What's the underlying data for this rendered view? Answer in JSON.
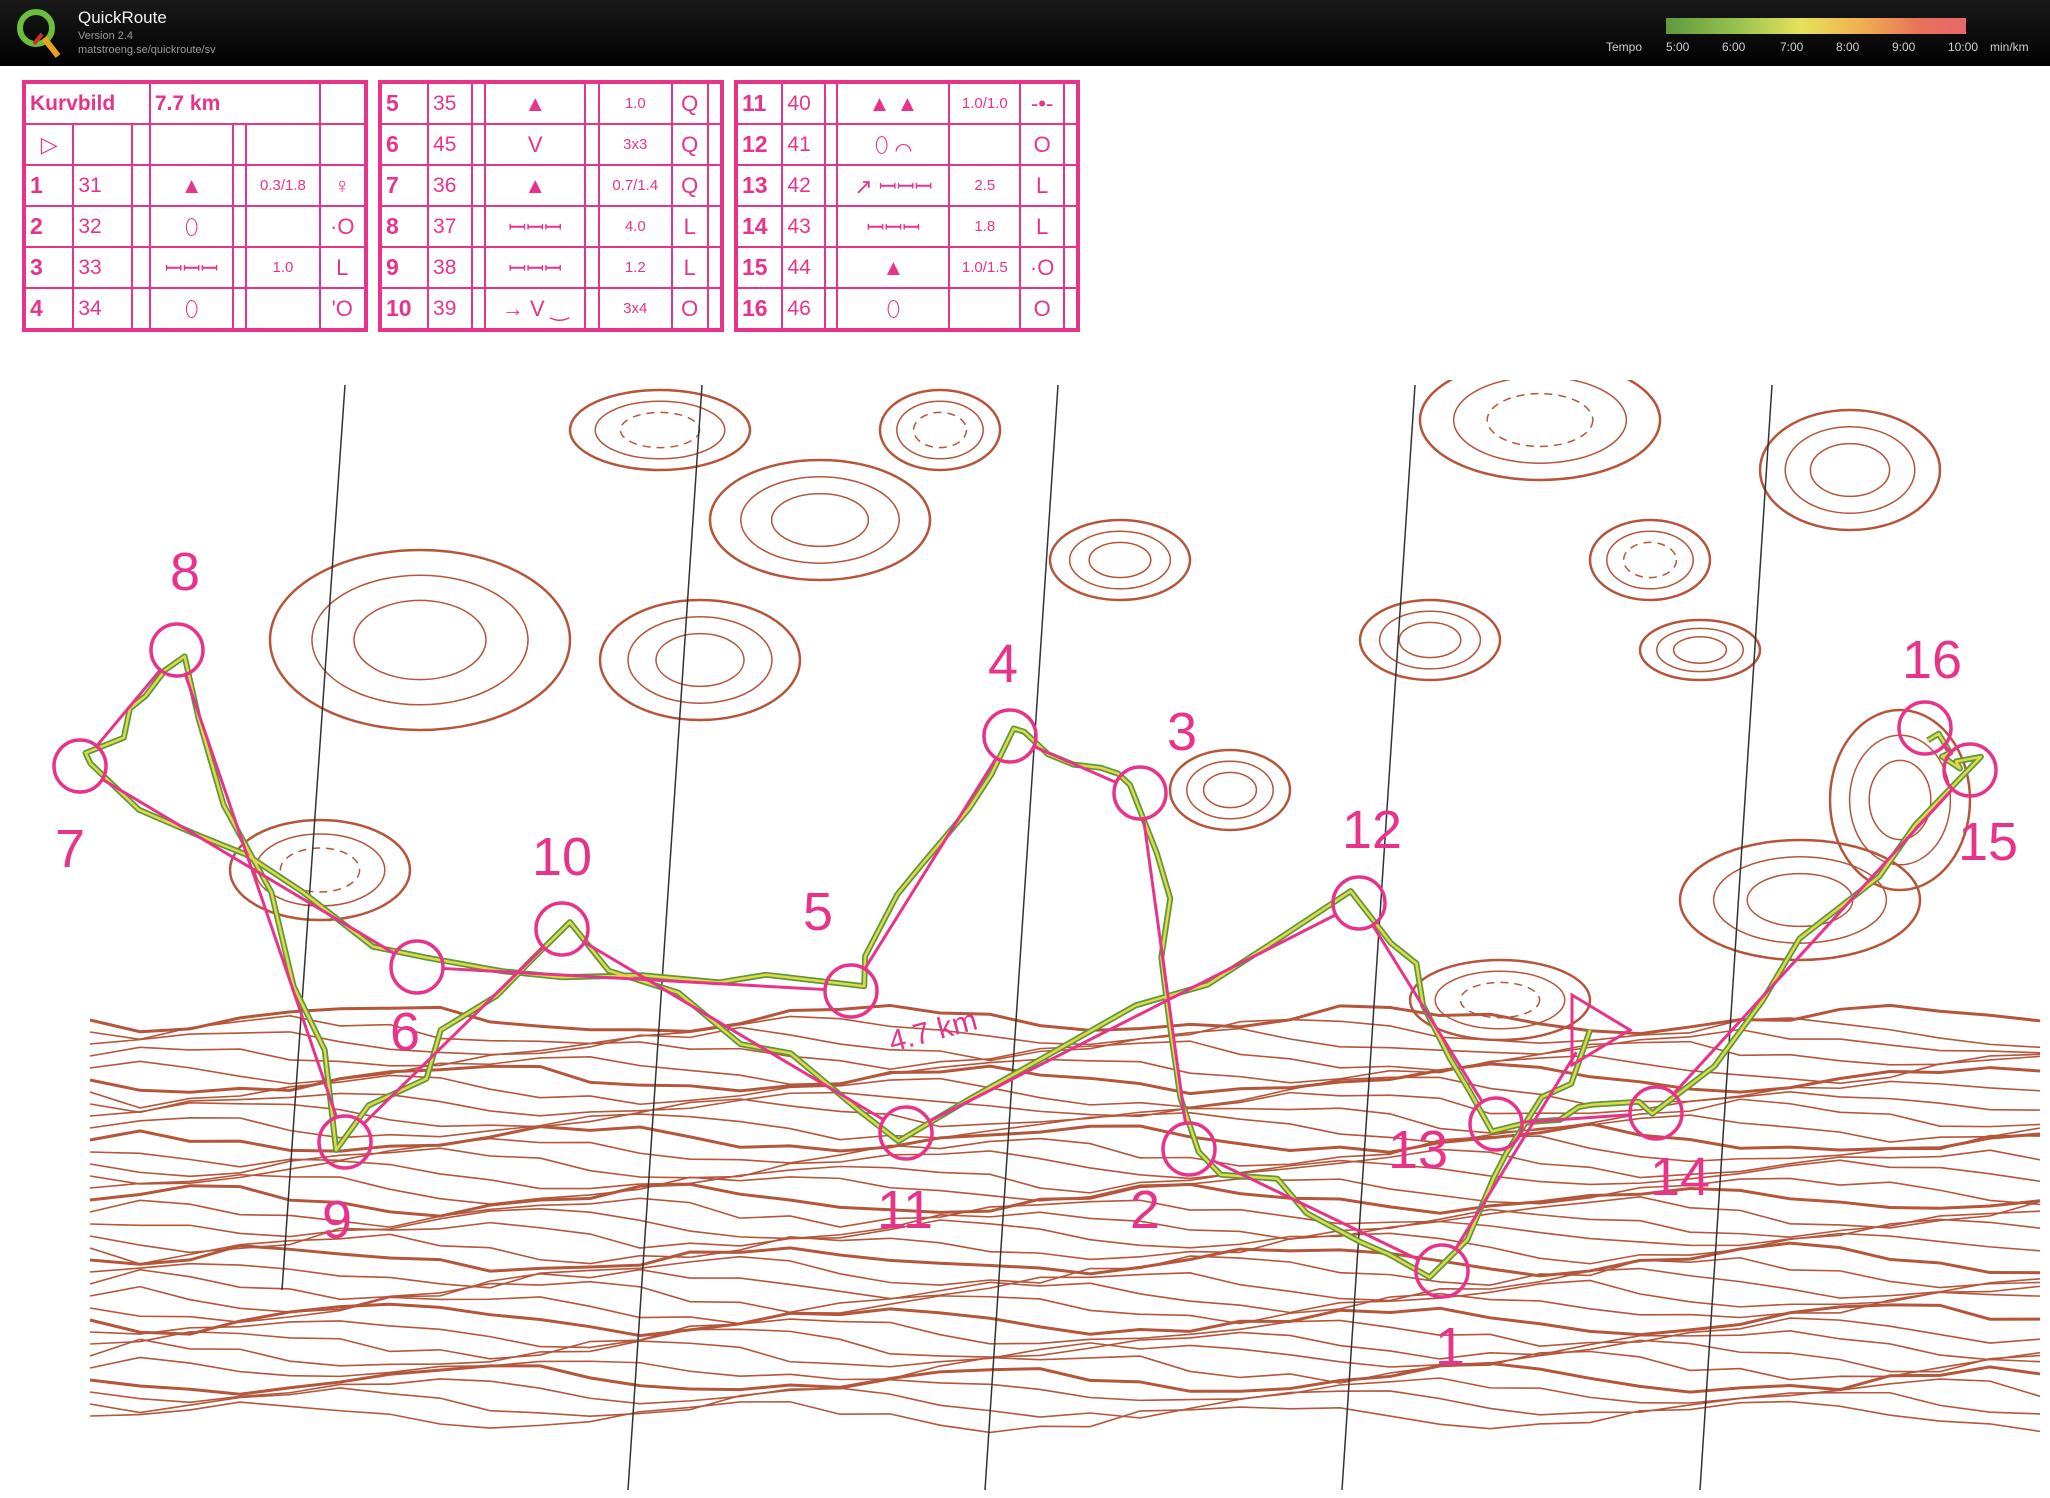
{
  "app": {
    "title": "QuickRoute",
    "version": "Version 2.4",
    "url": "matstroeng.se/quickroute/sv"
  },
  "tempo": {
    "label": "Tempo",
    "ticks": [
      "5:00",
      "6:00",
      "7:00",
      "8:00",
      "9:00",
      "10:00"
    ],
    "unit": "min/km"
  },
  "description": {
    "event": "Kurvbild",
    "length": "7.7 km",
    "start_symbol": "▷",
    "controls": [
      {
        "num": "1",
        "code": "31",
        "feature": "▲",
        "dim": "0.3/1.8",
        "pos": "♀"
      },
      {
        "num": "2",
        "code": "32",
        "feature": "⬯",
        "dim": "",
        "pos": "·O"
      },
      {
        "num": "3",
        "code": "33",
        "feature": "ꟷꟷꟷ",
        "dim": "1.0",
        "pos": "L"
      },
      {
        "num": "4",
        "code": "34",
        "feature": "⬯",
        "dim": "",
        "pos": "'O"
      },
      {
        "num": "5",
        "code": "35",
        "feature": "▲",
        "dim": "1.0",
        "pos": "Q"
      },
      {
        "num": "6",
        "code": "45",
        "feature": "V",
        "dim": "3x3",
        "pos": "Q"
      },
      {
        "num": "7",
        "code": "36",
        "feature": "▲",
        "dim": "0.7/1.4",
        "pos": "Q"
      },
      {
        "num": "8",
        "code": "37",
        "feature": "ꟷꟷꟷ",
        "dim": "4.0",
        "pos": "L"
      },
      {
        "num": "9",
        "code": "38",
        "feature": "ꟷꟷꟷ",
        "dim": "1.2",
        "pos": "L"
      },
      {
        "num": "10",
        "code": "39",
        "feature": "→ V ‿",
        "dim": "3x4",
        "pos": "O"
      },
      {
        "num": "11",
        "code": "40",
        "feature": "▲ ▲",
        "dim": "1.0/1.0",
        "pos": "-•-"
      },
      {
        "num": "12",
        "code": "41",
        "feature": "⬯ ⌒",
        "dim": "",
        "pos": "O"
      },
      {
        "num": "13",
        "code": "42",
        "feature": "↗ ꟷꟷꟷ",
        "dim": "2.5",
        "pos": "L"
      },
      {
        "num": "14",
        "code": "43",
        "feature": "ꟷꟷꟷ",
        "dim": "1.8",
        "pos": "L"
      },
      {
        "num": "15",
        "code": "44",
        "feature": "▲",
        "dim": "1.0/1.5",
        "pos": "·O"
      },
      {
        "num": "16",
        "code": "46",
        "feature": "⬯",
        "dim": "",
        "pos": "O"
      }
    ]
  },
  "map": {
    "distance_label": "4.7 km",
    "colors": {
      "course": "#e8338a",
      "contour": "#b5553a",
      "route_outer": "#5a9a3a",
      "route_inner": "#e4d84a"
    },
    "controls": [
      {
        "num": "1"
      },
      {
        "num": "2"
      },
      {
        "num": "3"
      },
      {
        "num": "4"
      },
      {
        "num": "5"
      },
      {
        "num": "6"
      },
      {
        "num": "7"
      },
      {
        "num": "8"
      },
      {
        "num": "9"
      },
      {
        "num": "10"
      },
      {
        "num": "11"
      },
      {
        "num": "12"
      },
      {
        "num": "13"
      },
      {
        "num": "14"
      },
      {
        "num": "15"
      },
      {
        "num": "16"
      }
    ]
  }
}
